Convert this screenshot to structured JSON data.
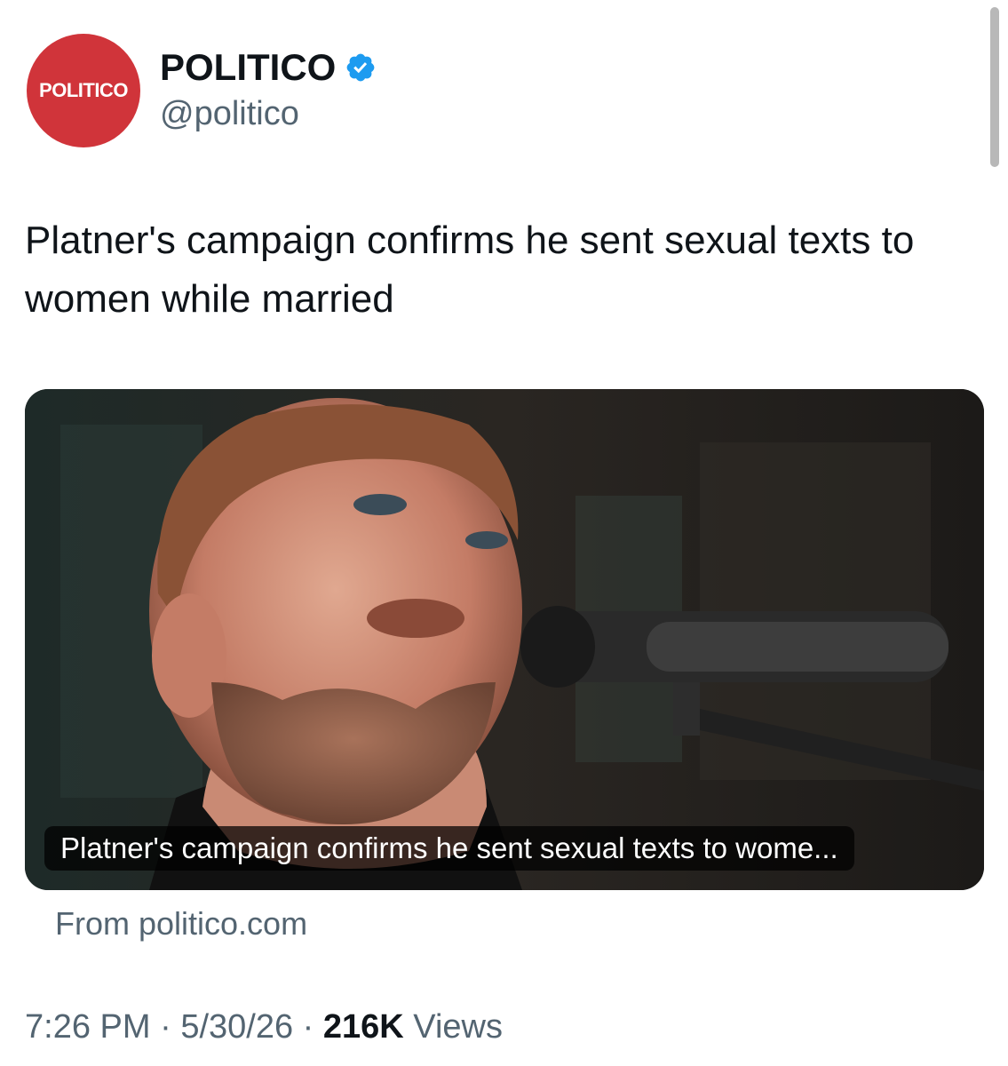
{
  "author": {
    "avatar_text": "POLITICO",
    "display_name": "POLITICO",
    "handle": "@politico",
    "verified": true,
    "brand_color": "#d0343a",
    "verified_color": "#1d9bf0"
  },
  "tweet": {
    "text": "Platner's campaign confirms he sent sexual texts to women while married"
  },
  "card": {
    "caption": "Platner's campaign confirms he sent sexual texts to wome...",
    "source": "From politico.com",
    "image_description_icon": "photo-of-speaker-at-microphone"
  },
  "meta": {
    "time": "7:26 PM",
    "date": "5/30/26",
    "views_count": "216K",
    "views_label": "Views",
    "separator": "·"
  }
}
